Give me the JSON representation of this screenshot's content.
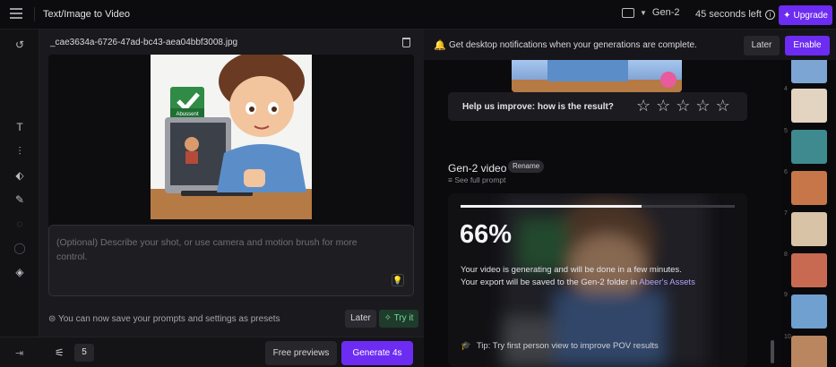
{
  "topbar": {
    "title": "Text/Image to Video",
    "folder": "Gen-2",
    "time_left": "45 seconds left",
    "upgrade_label": "Upgrade"
  },
  "left_panel": {
    "file_name": "_cae3634a-6726-47ad-bc43-aea04bbf3008.jpg",
    "image_badge_text": "Abussent",
    "prompt_placeholder": "(Optional) Describe your shot, or use camera and motion brush for more control.",
    "preset_notice": "You can now save your prompts and settings as presets",
    "later_label": "Later",
    "try_label": "Try it"
  },
  "bottom_bar": {
    "count": "5",
    "free_previews_label": "Free previews",
    "generate_label": "Generate 4s"
  },
  "notification": {
    "text": "Get desktop notifications when your generations are complete.",
    "later_label": "Later",
    "enable_label": "Enable"
  },
  "feedback": {
    "question": "Help us improve: how is the result?",
    "stars": 5
  },
  "generation": {
    "title": "Gen-2 video",
    "rename_label": "Rename",
    "see_full_prompt": "See full prompt",
    "progress": 0.66,
    "percent_label": "66%",
    "message_line1": "Your video is generating and will be done in a few minutes.",
    "message_line2_prefix": "Your export will be saved to the Gen-2 folder in",
    "assets_link": "Abeer's Assets",
    "tip": "Tip: Try first person view to improve POV results"
  },
  "thumbnails": [
    "4",
    "5",
    "6",
    "7",
    "8",
    "9",
    "10"
  ],
  "colors": {
    "accent": "#6c2cf2",
    "try_green": "#6fdc9b",
    "link_purple": "#b6a2f7"
  },
  "icons": {
    "rail": [
      "undo-icon",
      "text-icon",
      "sliders-icon",
      "camera-icon",
      "brush-icon",
      "circle-icon",
      "ring-icon",
      "layers-icon"
    ]
  }
}
